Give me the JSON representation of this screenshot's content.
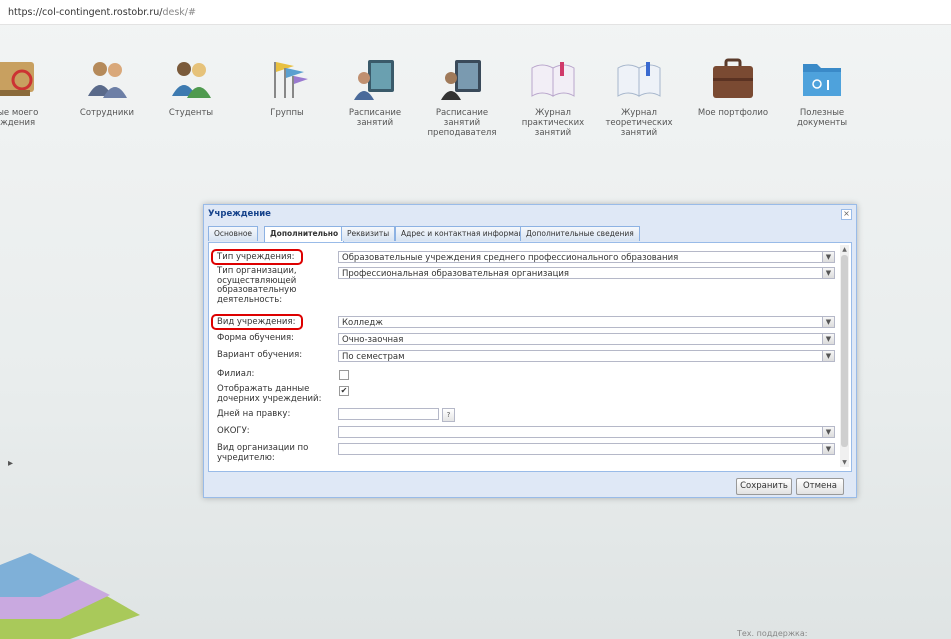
{
  "browser": {
    "url_host": "https://col-contingent.rostobr.ru/",
    "url_path": "desk/#"
  },
  "desk": {
    "apps": [
      {
        "label": "ные моего\nеждения",
        "icon": "institution-icon"
      },
      {
        "label": "Сотрудники",
        "icon": "staff-icon"
      },
      {
        "label": "Студенты",
        "icon": "students-icon"
      },
      {
        "label": "Группы",
        "icon": "groups-flags-icon"
      },
      {
        "label": "Расписание\nзанятий",
        "icon": "schedule-icon"
      },
      {
        "label": "Расписание\nзанятий\nпреподавателя",
        "icon": "teacher-schedule-icon"
      },
      {
        "label": "Журнал\nпрактических\nзанятий",
        "icon": "practical-journal-icon"
      },
      {
        "label": "Журнал\nтеоретических\nзанятий",
        "icon": "theory-journal-icon"
      },
      {
        "label": "Мое портфолио",
        "icon": "briefcase-icon"
      },
      {
        "label": "Полезные\nдокументы",
        "icon": "folder-icon"
      }
    ]
  },
  "dialog": {
    "title": "Учреждение",
    "close": "×",
    "tabs": [
      {
        "label": "Основное",
        "active": false
      },
      {
        "label": "Дополнительно",
        "active": true
      },
      {
        "label": "Реквизиты",
        "active": false
      },
      {
        "label": "Адрес и контактная информация",
        "active": false
      },
      {
        "label": "Дополнительные сведения",
        "active": false
      }
    ],
    "fields": {
      "type": {
        "label": "Тип учреждения:",
        "value": "Образовательные учреждения среднего профессионального образования"
      },
      "org_type": {
        "label": "Тип организации, осуществляющей образовательную деятельность:",
        "value": "Профессиональная образовательная организация"
      },
      "kind": {
        "label": "Вид учреждения:",
        "value": "Колледж"
      },
      "form": {
        "label": "Форма обучения:",
        "value": "Очно-заочная"
      },
      "variant": {
        "label": "Вариант обучения:",
        "value": "По семестрам"
      },
      "branch": {
        "label": "Филиал:",
        "checked": false
      },
      "show_children": {
        "label": "Отображать данные дочерних учреждений:",
        "checked": true
      },
      "days": {
        "label": "Дней на правку:",
        "value": "",
        "help": "?"
      },
      "okogu": {
        "label": "ОКОГУ:",
        "value": ""
      },
      "founder_kind": {
        "label": "Вид организации по учредителю:",
        "value": ""
      }
    },
    "buttons": {
      "save": "Сохранить",
      "cancel": "Отмена"
    }
  },
  "footer": {
    "support": "Тех. поддержка:"
  },
  "colors": {
    "highlight": "#dd0000",
    "dialog_border": "#99bbe8",
    "dialog_title": "#15428b"
  }
}
